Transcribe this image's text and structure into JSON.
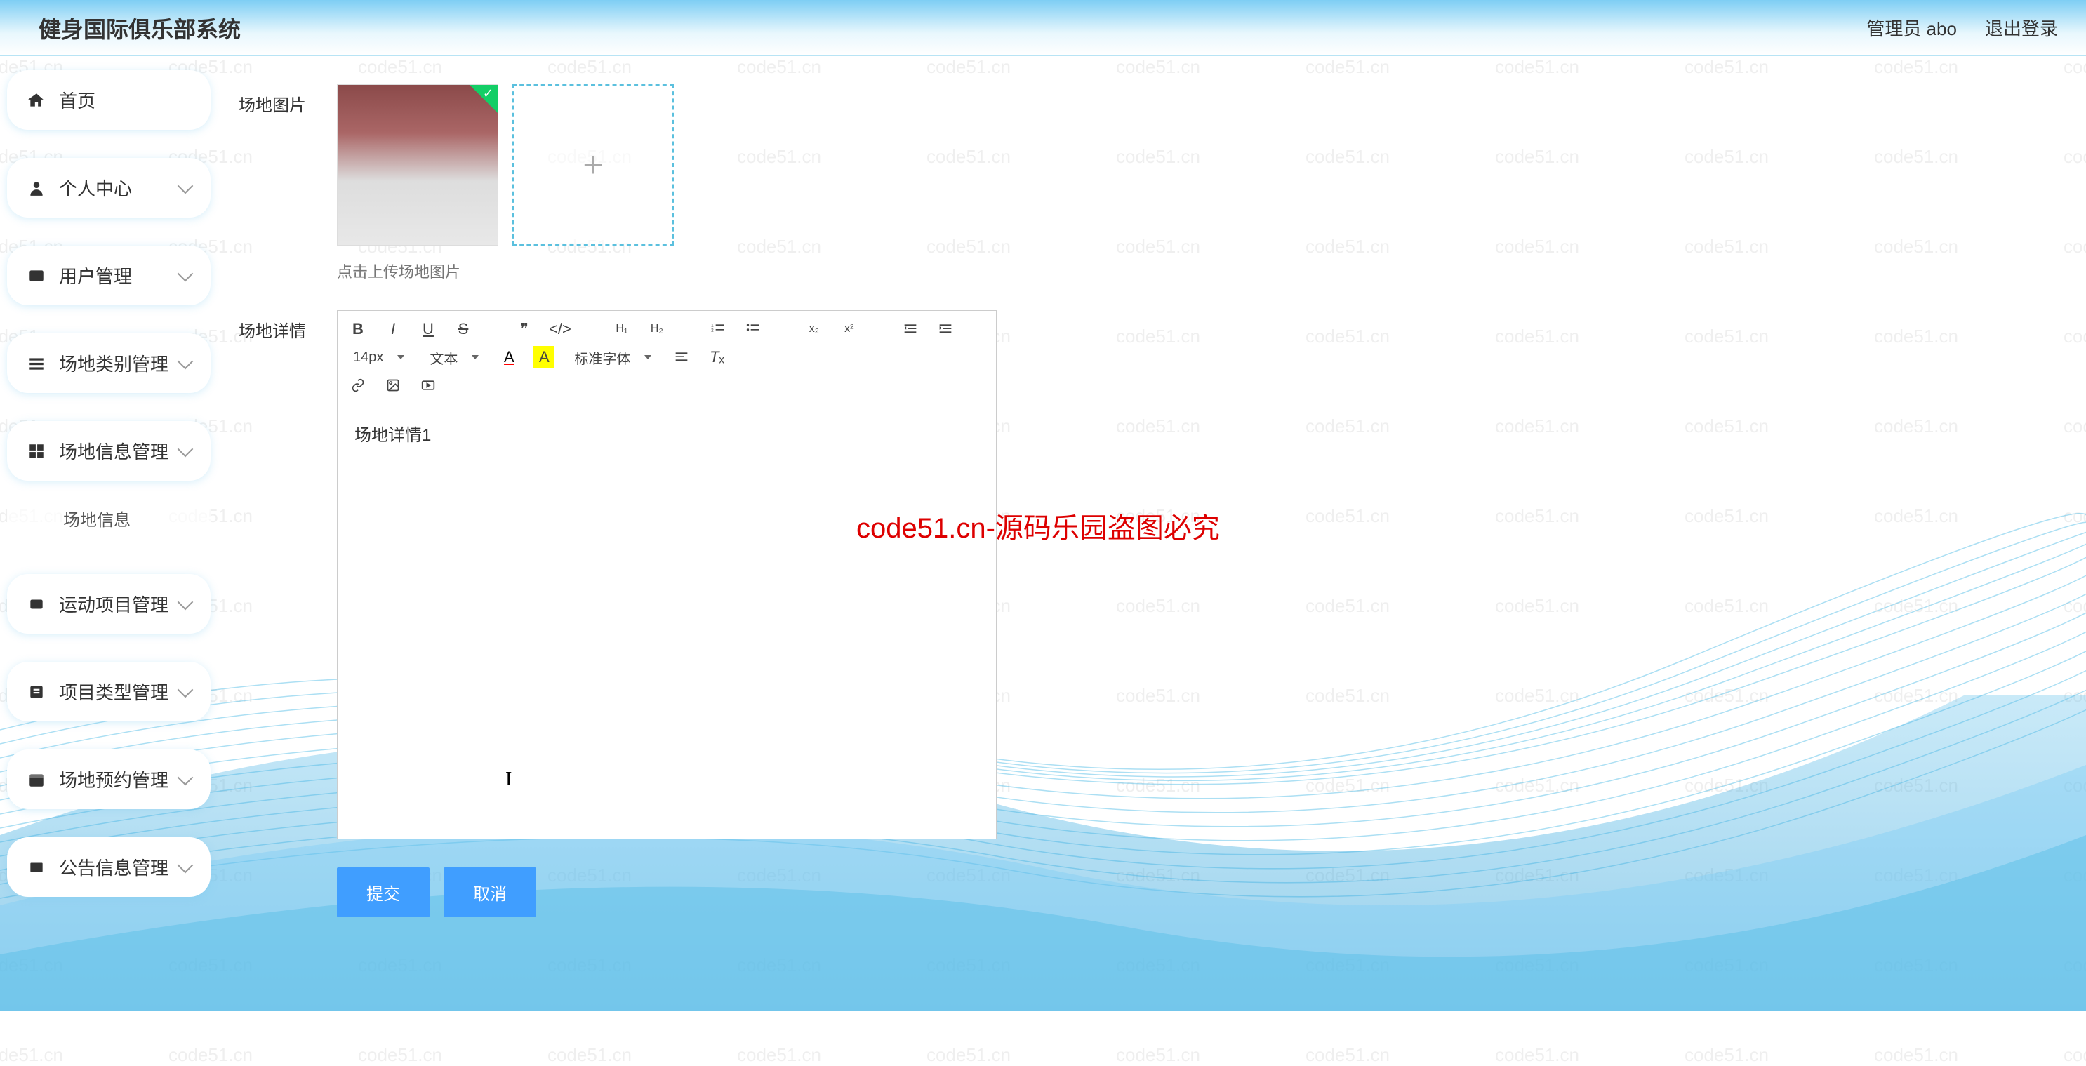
{
  "header": {
    "title": "健身国际俱乐部系统",
    "admin_label": "管理员 abo",
    "logout_label": "退出登录"
  },
  "sidebar": {
    "items": [
      {
        "icon": "home",
        "label": "首页",
        "children": false
      },
      {
        "icon": "user",
        "label": "个人中心",
        "children": true
      },
      {
        "icon": "users",
        "label": "用户管理",
        "children": true
      },
      {
        "icon": "list",
        "label": "场地类别管理",
        "children": true
      },
      {
        "icon": "grid",
        "label": "场地信息管理",
        "children": true,
        "sub": "场地信息"
      },
      {
        "icon": "activity",
        "label": "运动项目管理",
        "children": true
      },
      {
        "icon": "folder",
        "label": "项目类型管理",
        "children": true
      },
      {
        "icon": "calendar",
        "label": "场地预约管理",
        "children": true
      },
      {
        "icon": "bell",
        "label": "公告信息管理",
        "children": true
      }
    ]
  },
  "form": {
    "image_label": "场地图片",
    "upload_hint": "点击上传场地图片",
    "detail_label": "场地详情",
    "detail_content": "场地详情1",
    "submit_label": "提交",
    "cancel_label": "取消"
  },
  "editor": {
    "font_size": "14px",
    "format": "文本",
    "font_family": "标准字体"
  },
  "watermark": {
    "text": "code51.cn",
    "center": "code51.cn-源码乐园盗图必究"
  }
}
